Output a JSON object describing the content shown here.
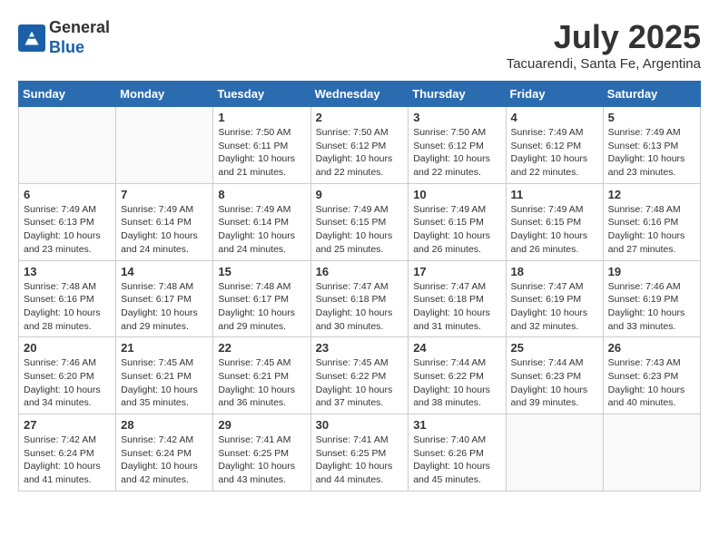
{
  "header": {
    "logo_line1": "General",
    "logo_line2": "Blue",
    "month": "July 2025",
    "location": "Tacuarendi, Santa Fe, Argentina"
  },
  "weekdays": [
    "Sunday",
    "Monday",
    "Tuesday",
    "Wednesday",
    "Thursday",
    "Friday",
    "Saturday"
  ],
  "weeks": [
    [
      {
        "day": "",
        "info": ""
      },
      {
        "day": "",
        "info": ""
      },
      {
        "day": "1",
        "info": "Sunrise: 7:50 AM\nSunset: 6:11 PM\nDaylight: 10 hours\nand 21 minutes."
      },
      {
        "day": "2",
        "info": "Sunrise: 7:50 AM\nSunset: 6:12 PM\nDaylight: 10 hours\nand 22 minutes."
      },
      {
        "day": "3",
        "info": "Sunrise: 7:50 AM\nSunset: 6:12 PM\nDaylight: 10 hours\nand 22 minutes."
      },
      {
        "day": "4",
        "info": "Sunrise: 7:49 AM\nSunset: 6:12 PM\nDaylight: 10 hours\nand 22 minutes."
      },
      {
        "day": "5",
        "info": "Sunrise: 7:49 AM\nSunset: 6:13 PM\nDaylight: 10 hours\nand 23 minutes."
      }
    ],
    [
      {
        "day": "6",
        "info": "Sunrise: 7:49 AM\nSunset: 6:13 PM\nDaylight: 10 hours\nand 23 minutes."
      },
      {
        "day": "7",
        "info": "Sunrise: 7:49 AM\nSunset: 6:14 PM\nDaylight: 10 hours\nand 24 minutes."
      },
      {
        "day": "8",
        "info": "Sunrise: 7:49 AM\nSunset: 6:14 PM\nDaylight: 10 hours\nand 24 minutes."
      },
      {
        "day": "9",
        "info": "Sunrise: 7:49 AM\nSunset: 6:15 PM\nDaylight: 10 hours\nand 25 minutes."
      },
      {
        "day": "10",
        "info": "Sunrise: 7:49 AM\nSunset: 6:15 PM\nDaylight: 10 hours\nand 26 minutes."
      },
      {
        "day": "11",
        "info": "Sunrise: 7:49 AM\nSunset: 6:15 PM\nDaylight: 10 hours\nand 26 minutes."
      },
      {
        "day": "12",
        "info": "Sunrise: 7:48 AM\nSunset: 6:16 PM\nDaylight: 10 hours\nand 27 minutes."
      }
    ],
    [
      {
        "day": "13",
        "info": "Sunrise: 7:48 AM\nSunset: 6:16 PM\nDaylight: 10 hours\nand 28 minutes."
      },
      {
        "day": "14",
        "info": "Sunrise: 7:48 AM\nSunset: 6:17 PM\nDaylight: 10 hours\nand 29 minutes."
      },
      {
        "day": "15",
        "info": "Sunrise: 7:48 AM\nSunset: 6:17 PM\nDaylight: 10 hours\nand 29 minutes."
      },
      {
        "day": "16",
        "info": "Sunrise: 7:47 AM\nSunset: 6:18 PM\nDaylight: 10 hours\nand 30 minutes."
      },
      {
        "day": "17",
        "info": "Sunrise: 7:47 AM\nSunset: 6:18 PM\nDaylight: 10 hours\nand 31 minutes."
      },
      {
        "day": "18",
        "info": "Sunrise: 7:47 AM\nSunset: 6:19 PM\nDaylight: 10 hours\nand 32 minutes."
      },
      {
        "day": "19",
        "info": "Sunrise: 7:46 AM\nSunset: 6:19 PM\nDaylight: 10 hours\nand 33 minutes."
      }
    ],
    [
      {
        "day": "20",
        "info": "Sunrise: 7:46 AM\nSunset: 6:20 PM\nDaylight: 10 hours\nand 34 minutes."
      },
      {
        "day": "21",
        "info": "Sunrise: 7:45 AM\nSunset: 6:21 PM\nDaylight: 10 hours\nand 35 minutes."
      },
      {
        "day": "22",
        "info": "Sunrise: 7:45 AM\nSunset: 6:21 PM\nDaylight: 10 hours\nand 36 minutes."
      },
      {
        "day": "23",
        "info": "Sunrise: 7:45 AM\nSunset: 6:22 PM\nDaylight: 10 hours\nand 37 minutes."
      },
      {
        "day": "24",
        "info": "Sunrise: 7:44 AM\nSunset: 6:22 PM\nDaylight: 10 hours\nand 38 minutes."
      },
      {
        "day": "25",
        "info": "Sunrise: 7:44 AM\nSunset: 6:23 PM\nDaylight: 10 hours\nand 39 minutes."
      },
      {
        "day": "26",
        "info": "Sunrise: 7:43 AM\nSunset: 6:23 PM\nDaylight: 10 hours\nand 40 minutes."
      }
    ],
    [
      {
        "day": "27",
        "info": "Sunrise: 7:42 AM\nSunset: 6:24 PM\nDaylight: 10 hours\nand 41 minutes."
      },
      {
        "day": "28",
        "info": "Sunrise: 7:42 AM\nSunset: 6:24 PM\nDaylight: 10 hours\nand 42 minutes."
      },
      {
        "day": "29",
        "info": "Sunrise: 7:41 AM\nSunset: 6:25 PM\nDaylight: 10 hours\nand 43 minutes."
      },
      {
        "day": "30",
        "info": "Sunrise: 7:41 AM\nSunset: 6:25 PM\nDaylight: 10 hours\nand 44 minutes."
      },
      {
        "day": "31",
        "info": "Sunrise: 7:40 AM\nSunset: 6:26 PM\nDaylight: 10 hours\nand 45 minutes."
      },
      {
        "day": "",
        "info": ""
      },
      {
        "day": "",
        "info": ""
      }
    ]
  ]
}
